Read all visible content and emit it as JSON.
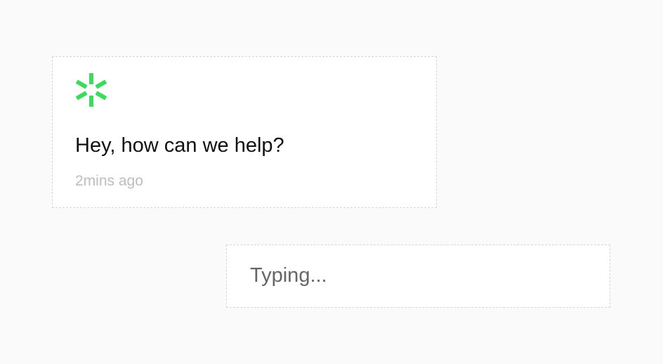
{
  "message": {
    "text": "Hey, how can we help?",
    "timestamp": "2mins ago",
    "logo_icon": "spark-burst-icon",
    "logo_color": "#3bdc5b"
  },
  "typing_indicator": {
    "text": "Typing..."
  },
  "colors": {
    "background": "#fafafa",
    "card_background": "#ffffff",
    "card_border": "#d6d6d6",
    "message_text": "#111111",
    "timestamp_text": "#bdbdbd",
    "typing_text": "#666666"
  }
}
